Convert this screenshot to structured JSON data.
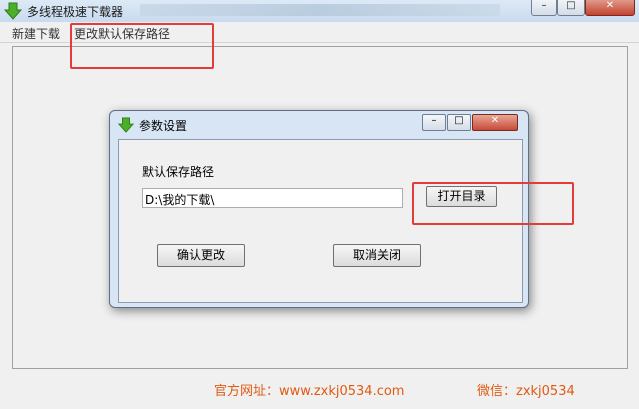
{
  "window": {
    "title": "多线程极速下载器",
    "icon": "green-down-arrow-icon"
  },
  "menu": {
    "items": [
      "新建下载",
      "更改默认保存路径"
    ]
  },
  "dialog": {
    "title": "参数设置",
    "icon": "green-down-arrow-icon",
    "path_label": "默认保存路径",
    "path_value": "D:\\我的下载\\",
    "open_dir_label": "打开目录",
    "confirm_label": "确认更改",
    "cancel_label": "取消关闭"
  },
  "footer": {
    "left": "官方网址：www.zxkj0534.com",
    "right": "微信：zxkj0534"
  },
  "colors": {
    "highlight": "#e53b3b",
    "footer_text": "#e05a12"
  }
}
